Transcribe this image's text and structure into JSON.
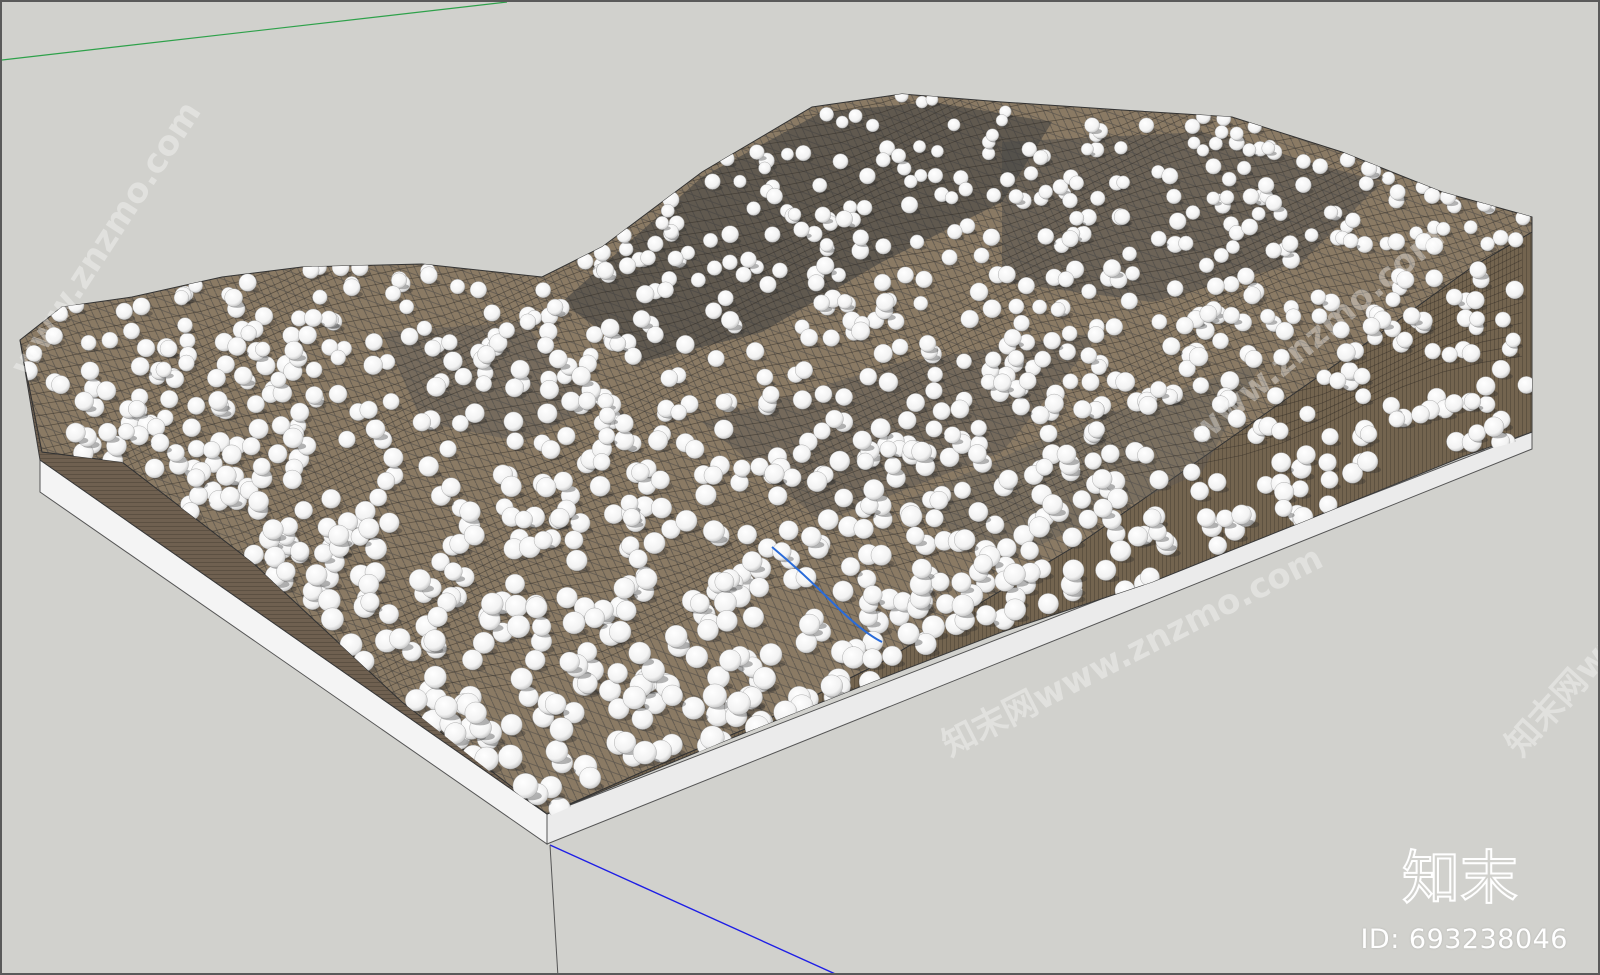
{
  "viewport": {
    "background": "#d1d1cd",
    "axis_colors": {
      "red": "#cc2222",
      "green": "#2ea14a",
      "blue": "#1e1ee6"
    }
  },
  "model": {
    "terrain_colors": {
      "soil": "#7a6a55",
      "soil_light": "#9a8a72",
      "mesh": "#4b4b4b",
      "side": "#6d5f50",
      "base": "#f3f3f3",
      "tree": "#ffffff"
    },
    "tree_count_visible": 1200
  },
  "watermarks": {
    "wm1": "www.znzmo.com",
    "wm2": "知末网www.znzmo.com",
    "wm3": "www.znzmo.com",
    "wm4": "知末网www"
  },
  "brand": {
    "logo_text": "知末",
    "id_text": "ID: 693238046"
  }
}
